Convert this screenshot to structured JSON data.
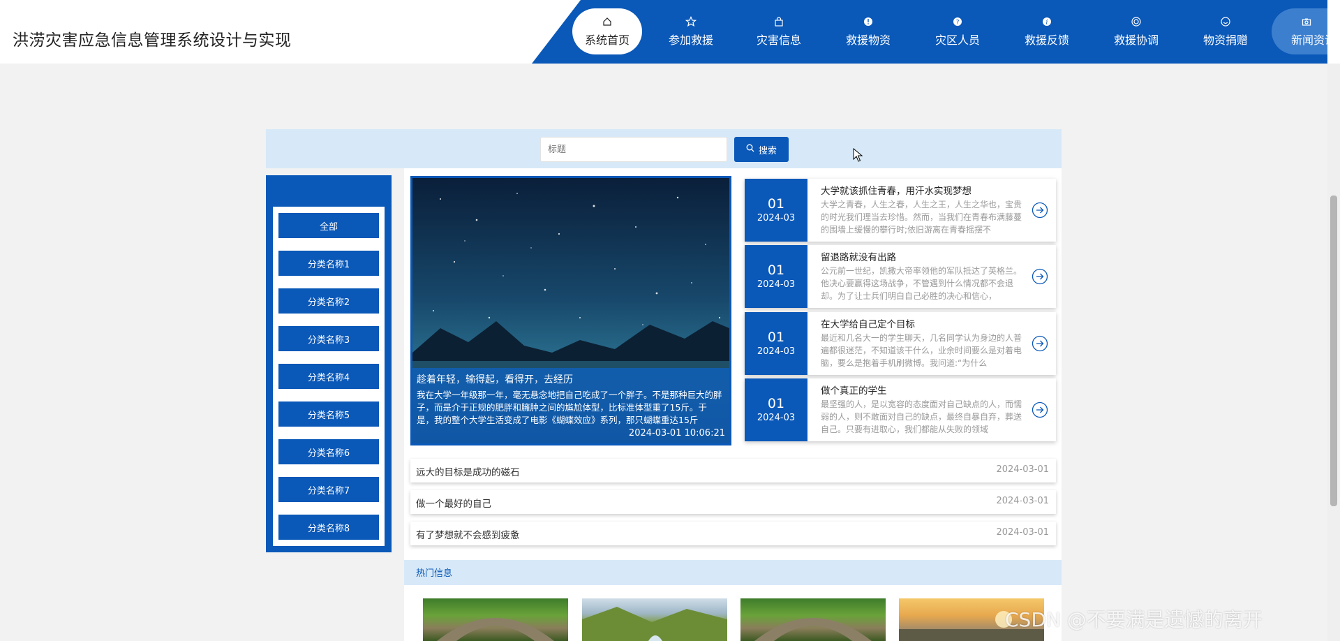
{
  "header": {
    "site_title": "洪涝灾害应急信息管理系统设计与实现",
    "nav": [
      {
        "label": "系统首页",
        "icon": "home-icon",
        "active": true
      },
      {
        "label": "参加救援",
        "icon": "star-icon"
      },
      {
        "label": "灾害信息",
        "icon": "bag-icon"
      },
      {
        "label": "救援物资",
        "icon": "warning-icon"
      },
      {
        "label": "灾区人员",
        "icon": "question-icon"
      },
      {
        "label": "救援反馈",
        "icon": "info-icon"
      },
      {
        "label": "救援协调",
        "icon": "target-icon"
      },
      {
        "label": "物资捐赠",
        "icon": "smile-icon"
      },
      {
        "label": "新闻资讯",
        "icon": "camera-icon"
      }
    ]
  },
  "search": {
    "placeholder": "标题",
    "button_label": "搜索"
  },
  "categories": [
    "全部",
    "分类名称1",
    "分类名称2",
    "分类名称3",
    "分类名称4",
    "分类名称5",
    "分类名称6",
    "分类名称7",
    "分类名称8"
  ],
  "featured": {
    "title": "趁着年轻，输得起，看得开，去经历",
    "desc": "我在大学一年级那一年，毫无悬念地把自己吃成了一个胖子。不是那种巨大的胖子，而是介于正规的肥胖和臃肿之间的尴尬体型，比标准体型重了15斤。于是，我的整个大学生活变成了电影《蝴蝶效应》系列，那只蝴蝶重达15斤",
    "time": "2024-03-01 10:06:21"
  },
  "news_cards": [
    {
      "day": "01",
      "ym": "2024-03",
      "title": "大学就该抓住青春，用汗水实现梦想",
      "summary": "大学之青春，人生之春，人生之王，人生之华也，宝贵的时光我们理当去珍惜。然而，当我们在青春布满藤蔓的围墙上缓慢的攀行时;依旧游离在青春摇摆不"
    },
    {
      "day": "01",
      "ym": "2024-03",
      "title": "留退路就没有出路",
      "summary": "公元前一世纪，凯撒大帝率领他的军队抵达了英格兰。他决心要赢得这场战争，不管遇到什么情况都不会退却。为了让士兵们明白自己必胜的决心和信心，"
    },
    {
      "day": "01",
      "ym": "2024-03",
      "title": "在大学给自己定个目标",
      "summary": "最近和几名大一的学生聊天，几名同学认为身边的人普遍都很迷茫，不知道该干什么，业余时间要么是对着电脑，要么是抱着手机刷微博。我问道:“为什么"
    },
    {
      "day": "01",
      "ym": "2024-03",
      "title": "做个真正的学生",
      "summary": "最坚强的人，是以宽容的态度面对自己缺点的人，而懦弱的人，则不敢面对自己的缺点，最终自暴自弃，葬送自己。只要有进取心，我们都能从失败的领域"
    }
  ],
  "list_rows": [
    {
      "title": "远大的目标是成功的磁石",
      "date": "2024-03-01"
    },
    {
      "title": "做一个最好的自己",
      "date": "2024-03-01"
    },
    {
      "title": "有了梦想就不会感到疲惫",
      "date": "2024-03-01"
    }
  ],
  "hot": {
    "label": "热门信息"
  },
  "watermark": "CSDN @不要满是遗憾的离开",
  "colors": {
    "primary": "#0a58b8",
    "light_band": "#d7e9f8",
    "page_bg": "#f2f2f2"
  }
}
